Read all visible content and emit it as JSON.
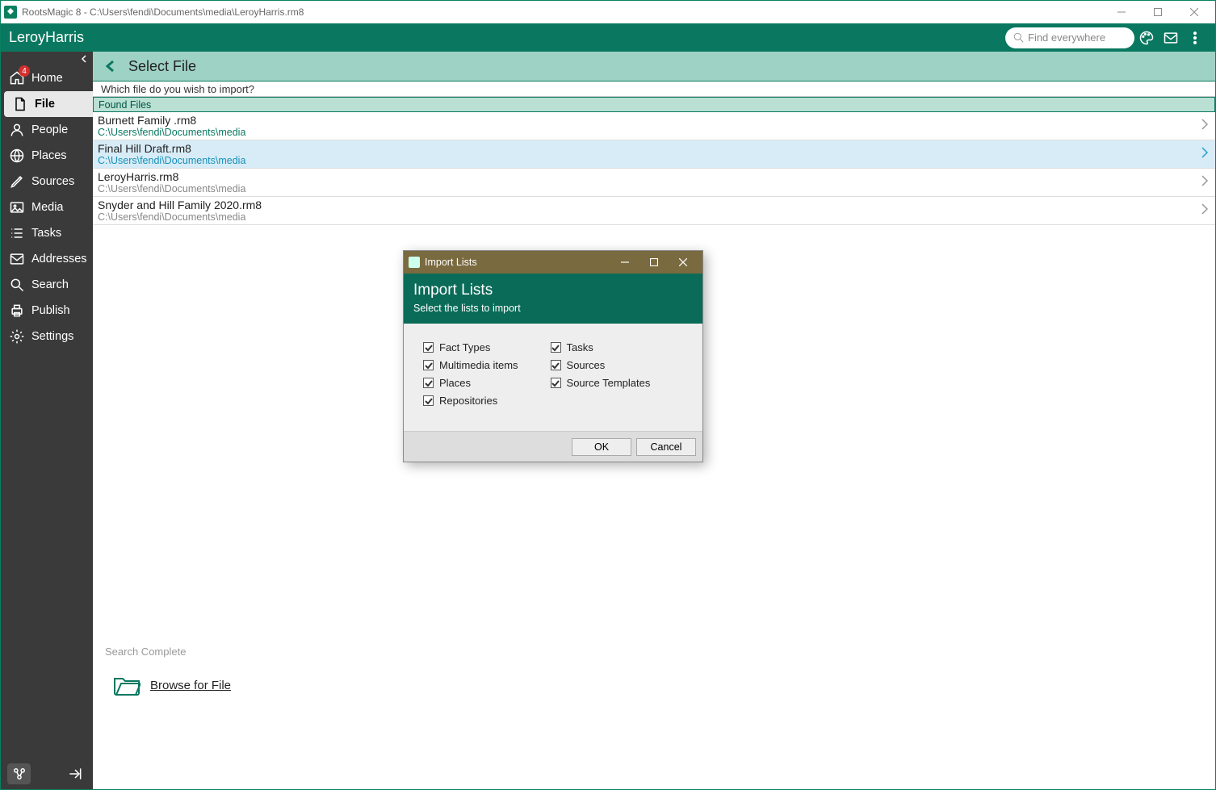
{
  "titlebar": {
    "text": "RootsMagic 8 - C:\\Users\\fendi\\Documents\\media\\LeroyHarris.rm8"
  },
  "header": {
    "db_name": "LeroyHarris",
    "search_placeholder": "Find everywhere"
  },
  "sidebar": {
    "items": [
      {
        "label": "Home",
        "icon": "home",
        "badge": "4"
      },
      {
        "label": "File",
        "icon": "file",
        "active": true
      },
      {
        "label": "People",
        "icon": "people"
      },
      {
        "label": "Places",
        "icon": "globe"
      },
      {
        "label": "Sources",
        "icon": "pen"
      },
      {
        "label": "Media",
        "icon": "image"
      },
      {
        "label": "Tasks",
        "icon": "list"
      },
      {
        "label": "Addresses",
        "icon": "mail"
      },
      {
        "label": "Search",
        "icon": "search"
      },
      {
        "label": "Publish",
        "icon": "print"
      },
      {
        "label": "Settings",
        "icon": "gear"
      }
    ]
  },
  "page": {
    "title": "Select File",
    "prompt": "Which file do you wish to import?",
    "found_header": "Found Files",
    "search_status": "Search Complete",
    "browse_label": "Browse for File"
  },
  "files": [
    {
      "name": "Burnett Family .rm8",
      "path": "C:\\Users\\fendi\\Documents\\media",
      "first": true
    },
    {
      "name": "Final Hill Draft.rm8",
      "path": "C:\\Users\\fendi\\Documents\\media",
      "selected": true
    },
    {
      "name": "LeroyHarris.rm8",
      "path": "C:\\Users\\fendi\\Documents\\media"
    },
    {
      "name": "Snyder and Hill Family 2020.rm8",
      "path": "C:\\Users\\fendi\\Documents\\media"
    }
  ],
  "dialog": {
    "titlebar": "Import Lists",
    "title": "Import Lists",
    "subtitle": "Select the lists to import",
    "left_checks": [
      {
        "label": "Fact Types",
        "checked": true
      },
      {
        "label": "Multimedia items",
        "checked": true
      },
      {
        "label": "Places",
        "checked": true
      },
      {
        "label": "Repositories",
        "checked": true
      }
    ],
    "right_checks": [
      {
        "label": "Tasks",
        "checked": true
      },
      {
        "label": "Sources",
        "checked": true
      },
      {
        "label": "Source Templates",
        "checked": true
      }
    ],
    "ok": "OK",
    "cancel": "Cancel"
  }
}
